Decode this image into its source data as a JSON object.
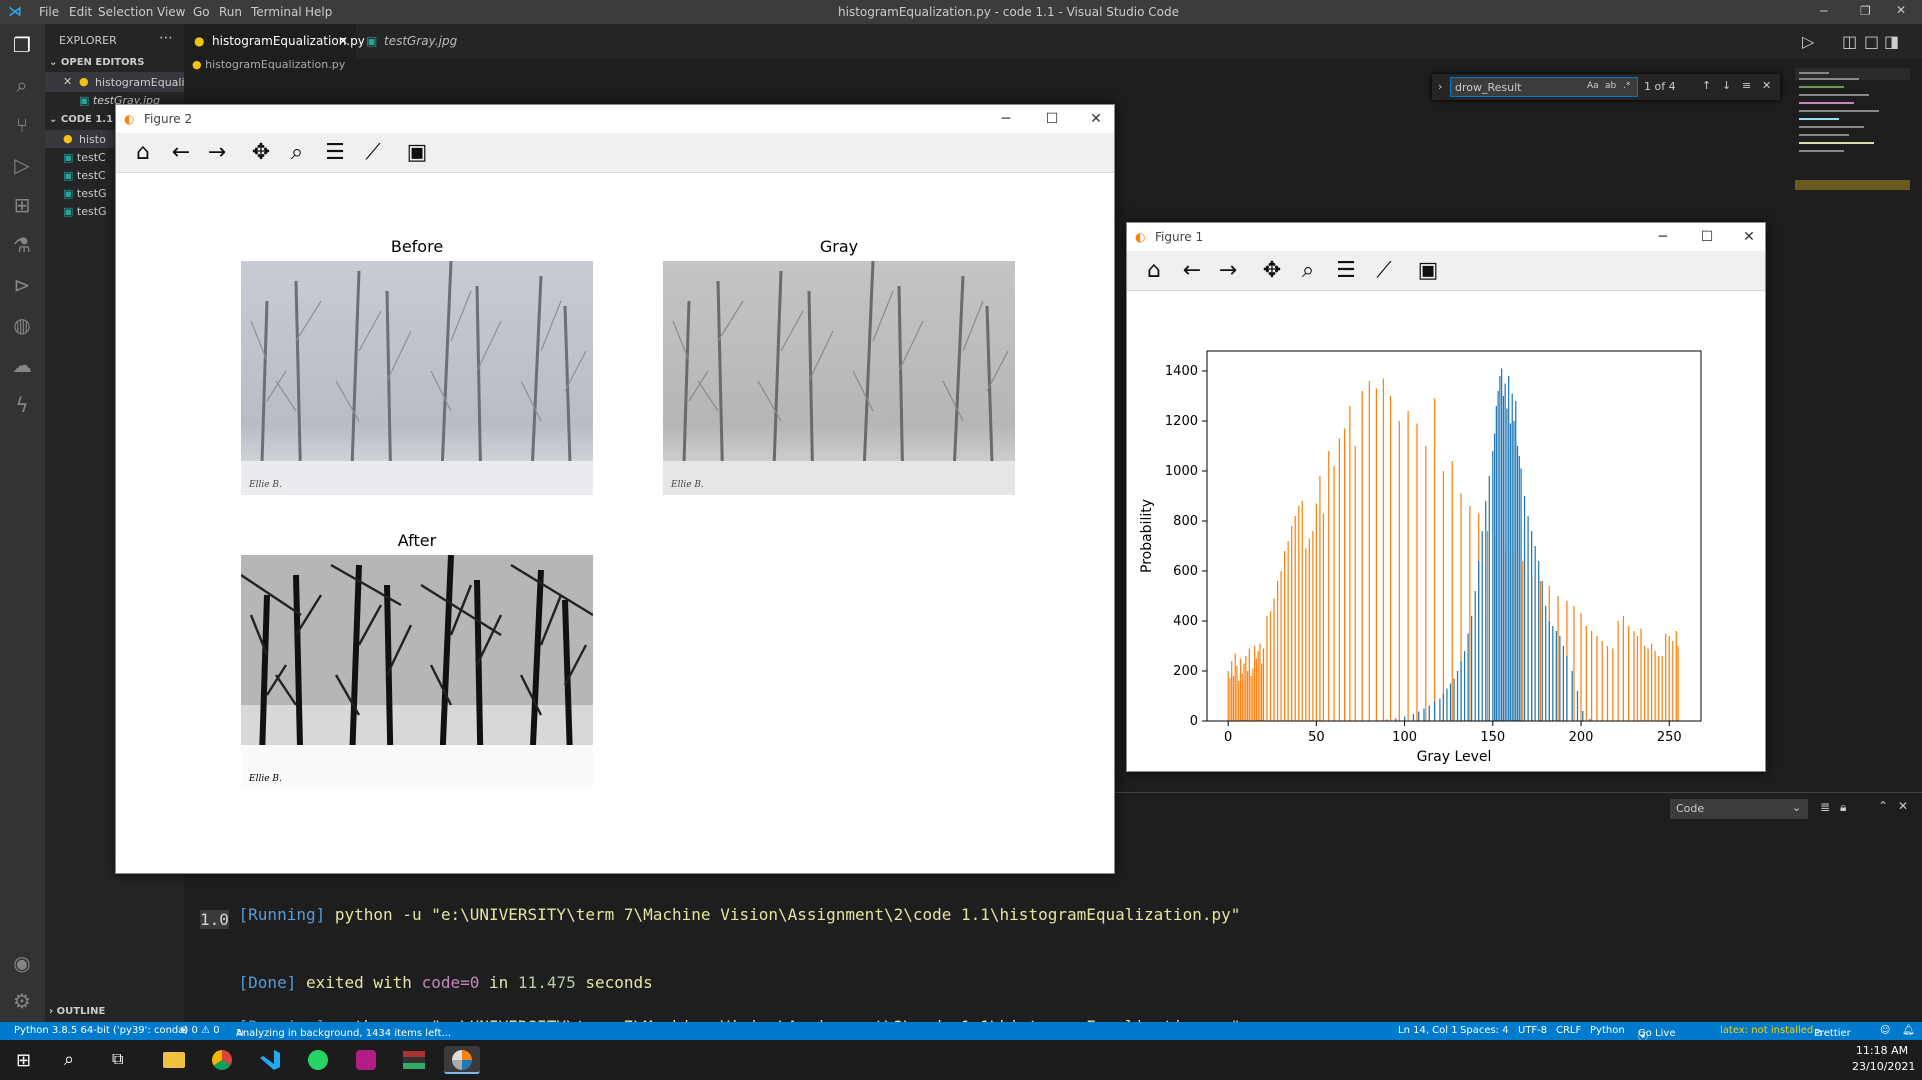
{
  "vscode": {
    "menu": [
      "File",
      "Edit",
      "Selection",
      "View",
      "Go",
      "Run",
      "Terminal",
      "Help"
    ],
    "window_title": "histogramEqualization.py - code 1.1 - Visual Studio Code",
    "explorer_title": "EXPLORER",
    "open_editors_label": "OPEN EDITORS",
    "open_editors": [
      "histogramEquali...",
      "testGray.jpg"
    ],
    "folder_label": "CODE 1.1",
    "folder_items": [
      "histo",
      "testC",
      "testC",
      "testG",
      "testG"
    ],
    "outline_label": "OUTLINE",
    "tabs": [
      "histogramEqualization.py",
      "testGray.jpg"
    ],
    "breadcrumb": "histogramEqualization.py",
    "find": {
      "value": "drow_Result",
      "count": "1 of 4",
      "opts": [
        "Aa",
        "ab",
        ".*"
      ]
    },
    "panel_dropdown": "Code",
    "terminal": {
      "running_tag": "[Running]",
      "command": "python -u \"e:\\UNIVERSITY\\term 7\\Machine Vision\\Assignment\\2\\code 1.1\\histogramEqualization.py\"",
      "output": "1.0",
      "done_tag": "[Done]",
      "done_text": "exited with",
      "done_code": "code=0",
      "done_in": "in",
      "done_seconds": "11.475",
      "done_unit": "seconds"
    },
    "status": {
      "python": "Python 3.8.5 64-bit ('py39': conda)",
      "problems": "⊗ 0 ⚠ 0",
      "analyzing": "Analyzing in background, 1434 items left...",
      "position": "Ln 14, Col 1",
      "spaces": "Spaces: 4",
      "encoding": "UTF-8",
      "eol": "CRLF",
      "language": "Python",
      "golive": "Go Live",
      "latex": "latex: not installed",
      "prettier": "Prettier"
    }
  },
  "figure2": {
    "title": "Figure 2",
    "images": {
      "before": "Before",
      "gray": "Gray",
      "after": "After"
    }
  },
  "figure1": {
    "title": "Figure 1"
  },
  "taskbar": {
    "time": "11:18 AM",
    "date": "23/10/2021"
  },
  "colors": {
    "accent": "#007acc",
    "orange": "#ff7f0e",
    "blue": "#1f77b4"
  },
  "chart_data": {
    "type": "bar",
    "xlabel": "Gray Level",
    "ylabel": "Probability",
    "xlim": [
      -12,
      268
    ],
    "ylim": [
      0,
      1480
    ],
    "xticks": [
      0,
      50,
      100,
      150,
      200,
      250
    ],
    "yticks": [
      0,
      200,
      400,
      600,
      800,
      1000,
      1200,
      1400
    ],
    "series": [
      {
        "color": "#ff7f0e",
        "x": [
          0,
          1,
          2,
          3,
          4,
          5,
          6,
          7,
          8,
          9,
          10,
          11,
          12,
          13,
          14,
          15,
          16,
          17,
          18,
          19,
          20,
          22,
          24,
          26,
          28,
          30,
          32,
          34,
          36,
          38,
          40,
          42,
          44,
          46,
          48,
          50,
          52,
          54,
          57,
          60,
          63,
          66,
          69,
          72,
          76,
          80,
          84,
          88,
          92,
          97,
          102,
          107,
          112,
          117,
          122,
          127,
          132,
          137,
          142,
          147,
          152,
          157,
          162,
          167,
          172,
          177,
          182,
          187,
          192,
          196,
          200,
          203,
          206,
          209,
          212,
          215,
          218,
          221,
          224,
          227,
          230,
          232,
          234,
          236,
          238,
          240,
          242,
          244,
          246,
          248,
          250,
          252,
          254,
          255
        ],
        "values": [
          200,
          170,
          240,
          180,
          270,
          220,
          160,
          250,
          190,
          230,
          260,
          200,
          290,
          180,
          210,
          300,
          250,
          280,
          310,
          230,
          290,
          420,
          440,
          490,
          560,
          600,
          680,
          720,
          780,
          820,
          860,
          880,
          690,
          730,
          760,
          870,
          980,
          830,
          1080,
          1020,
          1130,
          1170,
          1260,
          1100,
          1320,
          1360,
          1330,
          1370,
          1300,
          1200,
          1240,
          1190,
          1100,
          1290,
          1000,
          1040,
          910,
          860,
          830,
          760,
          740,
          680,
          680,
          640,
          580,
          560,
          540,
          500,
          480,
          460,
          430,
          380,
          360,
          340,
          320,
          300,
          290,
          400,
          420,
          380,
          360,
          340,
          370,
          300,
          290,
          310,
          280,
          260,
          260,
          350,
          340,
          320,
          360,
          300
        ]
      },
      {
        "color": "#1f77b4",
        "x": [
          85,
          90,
          95,
          100,
          105,
          108,
          111,
          114,
          117,
          120,
          122,
          124,
          126,
          128,
          130,
          132,
          134,
          136,
          138,
          140,
          142,
          144,
          146,
          148,
          150,
          151,
          152,
          153,
          154,
          155,
          156,
          157,
          158,
          159,
          160,
          161,
          162,
          163,
          164,
          165,
          166,
          168,
          170,
          172,
          174,
          176,
          178,
          180,
          182,
          184,
          186,
          188,
          190,
          192,
          195,
          198,
          201,
          205
        ],
        "values": [
          3,
          6,
          10,
          18,
          28,
          38,
          50,
          62,
          78,
          90,
          110,
          130,
          150,
          170,
          200,
          240,
          280,
          350,
          420,
          520,
          640,
          760,
          880,
          980,
          1080,
          1150,
          1260,
          1320,
          1380,
          1410,
          1300,
          1350,
          1250,
          1380,
          1190,
          1310,
          1200,
          1280,
          1100,
          1060,
          1010,
          900,
          820,
          760,
          700,
          640,
          560,
          460,
          400,
          380,
          360,
          340,
          300,
          260,
          200,
          120,
          40,
          8
        ]
      }
    ]
  }
}
